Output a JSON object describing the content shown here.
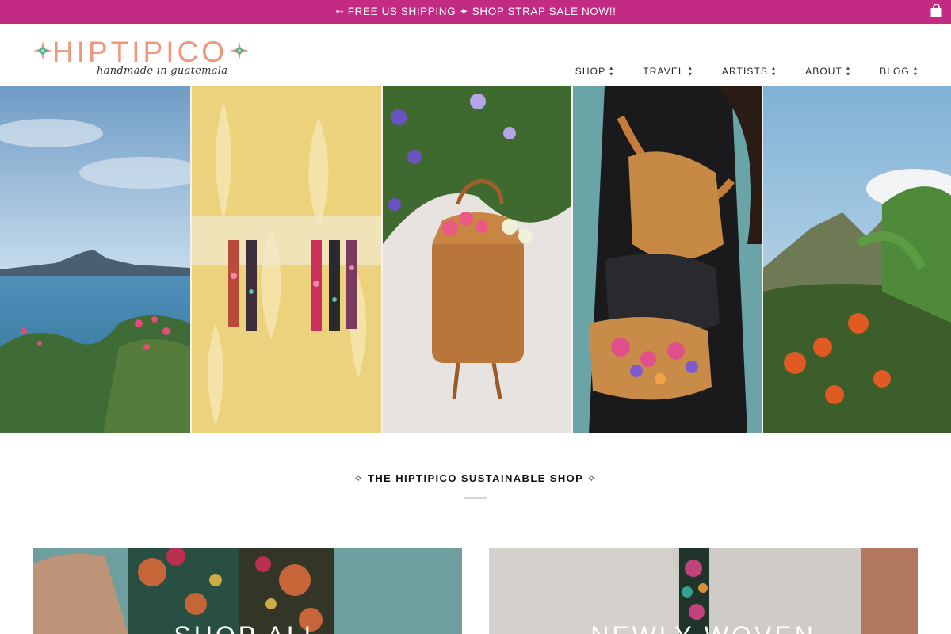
{
  "announcement": {
    "text": "➳ FREE US SHIPPING ✦ SHOP STRAP SALE NOW!!",
    "background": "#c22a83",
    "cart_icon": "shopping-bag-icon"
  },
  "brand": {
    "name": "HIPTIPICO",
    "tagline": "handmade in guatemala",
    "color": "#f0967a"
  },
  "nav": {
    "items": [
      {
        "label": "SHOP",
        "icon": "up-down-arrow-icon"
      },
      {
        "label": "TRAVEL",
        "icon": "up-down-arrow-icon"
      },
      {
        "label": "ARTISTS",
        "icon": "up-down-arrow-icon"
      },
      {
        "label": "ABOUT",
        "icon": "up-down-arrow-icon"
      },
      {
        "label": "BLOG",
        "icon": "up-down-arrow-icon"
      }
    ]
  },
  "hero": {
    "panels": [
      "lake-volcano-photo",
      "camera-straps-photo",
      "leather-backpack-flowers-photo",
      "fanny-packs-photo",
      "mountain-banana-plants-photo"
    ]
  },
  "section": {
    "title": "✧ THE HIPTIPICO SUSTAINABLE SHOP ✧"
  },
  "collections": [
    {
      "label": "SHOP ALL"
    },
    {
      "label": "NEWLY WOVEN"
    }
  ]
}
